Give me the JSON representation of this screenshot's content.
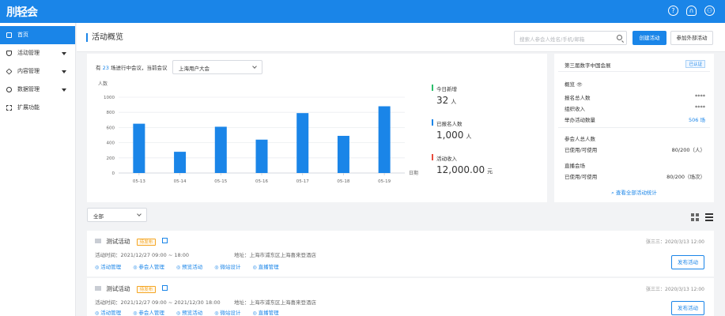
{
  "app": {
    "logo": "刖轻会"
  },
  "topbar": {
    "help_icon": "?",
    "headset_icon": "∩",
    "user_icon": "⚇"
  },
  "sidebar": {
    "items": [
      {
        "label": "首页",
        "icon": "home-icon",
        "active": true
      },
      {
        "label": "活动管理",
        "icon": "shield-icon",
        "caret": true
      },
      {
        "label": "内容管理",
        "icon": "cube-icon",
        "caret": true
      },
      {
        "label": "数据管理",
        "icon": "clock-icon",
        "caret": true
      },
      {
        "label": "扩展功能",
        "icon": "grid-icon"
      }
    ]
  },
  "header": {
    "title": "活动概览",
    "search_placeholder": "搜索人参会人姓名/手机/邮箱",
    "create_btn": "创建活动",
    "join_btn": "参加外部活动"
  },
  "stats": {
    "summary_prefix": "有",
    "summary_count": "23",
    "summary_suffix": "场进行中会议，当前会议",
    "current_meeting": "上海用户大会",
    "today_label": "今日新增",
    "today_value": "32",
    "today_unit": "人",
    "registered_label": "已报名人数",
    "registered_value": "1,000",
    "registered_unit": "人",
    "income_label": "活动收入",
    "income_value": "12,000.00",
    "income_unit": "元"
  },
  "chart_data": {
    "type": "bar",
    "categories": [
      "05-13",
      "05-14",
      "05-15",
      "05-16",
      "05-17",
      "05-18",
      "05-19"
    ],
    "values": [
      650,
      280,
      610,
      440,
      790,
      490,
      880
    ],
    "ylabel": "人数",
    "xlabel": "日期",
    "ylim": [
      0,
      1000
    ],
    "yticks": [
      "1000",
      "800",
      "600",
      "400",
      "200",
      "0"
    ],
    "bar_color": "#1a85e8"
  },
  "org": {
    "name": "第三届数字中国会展",
    "verified": "已认证",
    "overview_label": "概览",
    "rows": [
      {
        "label": "报名总人数",
        "value": "****"
      },
      {
        "label": "组织收入",
        "value": "****"
      },
      {
        "label": "举办活动数量",
        "value": "506 场"
      }
    ],
    "attendee_label": "参会人总人数",
    "attendee_used_label": "已使用/可使用",
    "attendee_used_value": "80/200（人）",
    "live_label": "直播会场",
    "live_used_label": "已使用/可使用",
    "live_used_value": "80/200（场次）",
    "view_all": "查看全部活动统计"
  },
  "filter": {
    "value": "全部"
  },
  "activities": [
    {
      "title": "测试活动",
      "tag": "待发布",
      "time_label": "活动时间：",
      "time": "2021/12/27  09:00 ~ 18:00",
      "addr_label": "地址：",
      "addr": "上海市浦东区上海喜来登酒店",
      "author": "张三三：2020/3/13  12:00",
      "publish_btn": "发布活动",
      "ops": [
        "活动管理",
        "参会人管理",
        "预览活动",
        "微站设计",
        "直播管理"
      ]
    },
    {
      "title": "测试活动",
      "tag": "待发布",
      "time_label": "活动时间：",
      "time": "2021/12/27  09:00 ~ 2021/12/30  18:00",
      "addr_label": "地址：",
      "addr": "上海市浦东区上海喜来登酒店",
      "author": "张三三：2020/3/13  12:00",
      "publish_btn": "发布活动",
      "ops": [
        "活动管理",
        "参会人管理",
        "预览活动",
        "微站设计",
        "直播管理"
      ]
    }
  ]
}
